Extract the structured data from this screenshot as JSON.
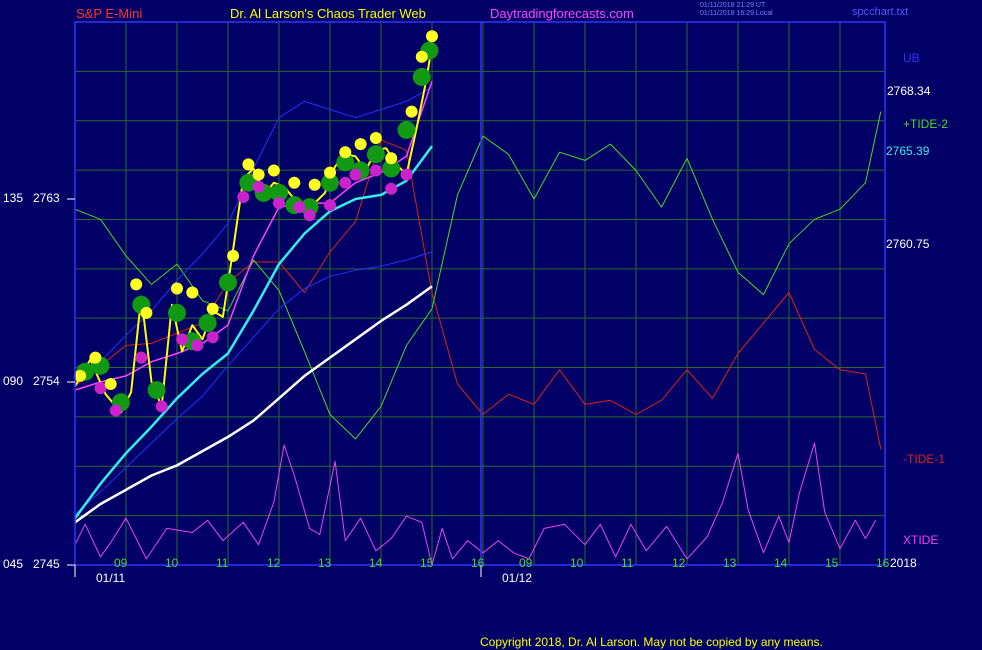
{
  "header": {
    "symbol": "S&P E-Mini",
    "author": "Dr. Al Larson's Chaos Trader Web",
    "site": "Daytradingforecasts.com",
    "timestamp_utc": "01/11/2018 21:29 UT",
    "timestamp_local": "01/11/2018 16:29 Local",
    "file": "spcchart.txt"
  },
  "right_labels": {
    "ub": "UB",
    "ub_price": "2768.34",
    "tide2": "+TIDE-2",
    "tide2_price": "2765.39",
    "mid_price": "2760.75",
    "tide1": "-TIDE-1",
    "xtide": "XTIDE",
    "year": "2018"
  },
  "footer": {
    "copyright": "Copyright 2018, Dr. Al Larson. May not be copied by any means."
  },
  "colors": {
    "background": "#000066",
    "grid": "#2a6a2a",
    "frame": "#3333ff",
    "price": "#ffff00",
    "ma_fast": "#ff44ff",
    "ma_slow": "#33eeee",
    "trend": "#ffffff",
    "band": "#2233ff",
    "tide_green": "#44dd22",
    "tide_red": "#dd2211",
    "xtide": "#ee44ee",
    "bull_marker": "#119911",
    "top_marker": "#ffff22",
    "bottom_marker": "#cc22cc"
  },
  "chart_data": {
    "type": "line",
    "x_ticks": [
      "09",
      "10",
      "11",
      "12",
      "13",
      "14",
      "15",
      "16",
      "09",
      "10",
      "11",
      "12",
      "13",
      "14",
      "15",
      "16"
    ],
    "dates": [
      "01/11",
      "01/12"
    ],
    "y_axis": [
      {
        "code": "135",
        "price": 2763
      },
      {
        "code": "090",
        "price": 2754
      },
      {
        "code": "045",
        "price": 2745
      }
    ],
    "ylim": [
      2745,
      2763
    ],
    "grid": true,
    "series": [
      {
        "name": "S&P E-Mini",
        "x": [
          0,
          0.3,
          0.6,
          0.9,
          1.1,
          1.3,
          1.5,
          1.7,
          1.9,
          2.1,
          2.3,
          2.5,
          2.7,
          2.9,
          3.1,
          3.3,
          3.5,
          3.7,
          3.9,
          4.1,
          4.3,
          4.5,
          4.7,
          4.9,
          5.1,
          5.3,
          5.5,
          5.7,
          5.9,
          6.1,
          6.3,
          6.5,
          6.7,
          6.9,
          7.0
        ],
        "values": [
          2753.8,
          2755.1,
          2753.4,
          2752.5,
          2753.5,
          2758.2,
          2754.0,
          2752.8,
          2757.8,
          2755.5,
          2756.8,
          2756.1,
          2757.5,
          2757.2,
          2760.5,
          2764.0,
          2764.5,
          2763.2,
          2763.8,
          2763.6,
          2763.0,
          2762.4,
          2762.8,
          2763.3,
          2764.6,
          2765.2,
          2765.1,
          2764.4,
          2765.4,
          2765.5,
          2764.7,
          2764.2,
          2766.5,
          2769.0,
          2770.6
        ]
      },
      {
        "name": "Fast MA",
        "x": [
          0,
          0.5,
          1.0,
          1.5,
          2.0,
          2.5,
          3.0,
          3.5,
          4.0,
          4.5,
          5.0,
          5.5,
          6.0,
          6.5,
          7.0
        ],
        "values": [
          2753.6,
          2754.0,
          2754.3,
          2755.0,
          2755.4,
          2755.9,
          2756.8,
          2760.2,
          2762.6,
          2762.8,
          2762.8,
          2763.8,
          2764.3,
          2765.1,
          2768.8
        ]
      },
      {
        "name": "Slow MA",
        "x": [
          0,
          0.5,
          1.0,
          1.5,
          2.0,
          2.5,
          3.0,
          3.5,
          4.0,
          4.5,
          5.0,
          5.5,
          6.0,
          6.5,
          7.0
        ],
        "values": [
          2747.3,
          2749.0,
          2750.5,
          2751.8,
          2753.2,
          2754.4,
          2755.4,
          2757.5,
          2759.8,
          2761.3,
          2762.4,
          2763.0,
          2763.2,
          2763.9,
          2765.6
        ]
      },
      {
        "name": "Trend",
        "x": [
          0,
          0.5,
          1.0,
          1.5,
          2.0,
          2.5,
          3.0,
          3.5,
          4.0,
          4.5,
          5.0,
          5.5,
          6.0,
          6.5,
          7.0
        ],
        "values": [
          2747.1,
          2748.0,
          2748.7,
          2749.4,
          2749.9,
          2750.6,
          2751.3,
          2752.1,
          2753.2,
          2754.3,
          2755.2,
          2756.1,
          2757.0,
          2757.8,
          2758.7
        ]
      },
      {
        "name": "+TIDE-2",
        "x": [
          0,
          0.5,
          1.0,
          1.5,
          2.0,
          2.5,
          3.0,
          3.5,
          4.0,
          4.5,
          5.0,
          5.5,
          6.0,
          6.5,
          7.0,
          7.5,
          8.0,
          8.5,
          9.0,
          9.5,
          10.0,
          10.5,
          11.0,
          11.5,
          12.0,
          12.5,
          13.0,
          13.5,
          14.0,
          14.5,
          15.0,
          15.5,
          15.8
        ],
        "values": [
          2762.5,
          2762.0,
          2760.2,
          2758.8,
          2759.8,
          2758.0,
          2757.5,
          2760.0,
          2758.5,
          2755.5,
          2752.4,
          2751.2,
          2752.8,
          2755.8,
          2757.6,
          2763.2,
          2766.1,
          2765.2,
          2763.0,
          2765.3,
          2764.9,
          2765.7,
          2764.4,
          2762.6,
          2765.0,
          2762.0,
          2759.4,
          2758.3,
          2760.8,
          2762.0,
          2762.5,
          2763.8,
          2767.3
        ]
      },
      {
        "name": "-TIDE-1",
        "x": [
          0,
          0.5,
          1.0,
          1.5,
          2.0,
          2.5,
          3.0,
          3.5,
          4.0,
          4.5,
          5.0,
          5.5,
          6.0,
          6.5,
          7.0,
          7.5,
          8.0,
          8.5,
          9.0,
          9.5,
          10.0,
          10.5,
          11.0,
          11.5,
          12.0,
          12.5,
          13.0,
          13.5,
          14.0,
          14.5,
          15.0,
          15.5,
          15.8
        ],
        "values": [
          2753.8,
          2754.8,
          2755.8,
          2755.9,
          2756.4,
          2756.9,
          2758.9,
          2759.9,
          2759.9,
          2758.4,
          2760.4,
          2761.9,
          2765.9,
          2765.4,
          2758.4,
          2753.9,
          2752.4,
          2753.4,
          2752.9,
          2754.6,
          2752.9,
          2753.1,
          2752.4,
          2753.1,
          2754.6,
          2753.2,
          2755.4,
          2756.9,
          2758.4,
          2755.6,
          2754.6,
          2754.4,
          2750.7
        ]
      },
      {
        "name": "UB",
        "x": [
          0,
          0.5,
          1.0,
          1.5,
          2.0,
          2.5,
          3.0,
          3.5,
          4.0,
          4.5,
          5.0,
          5.5,
          6.0,
          6.5,
          7.0
        ],
        "values": [
          2754.2,
          2755.0,
          2756.3,
          2757.5,
          2759.0,
          2760.3,
          2761.8,
          2764.5,
          2767.0,
          2767.8,
          2767.4,
          2767.0,
          2767.4,
          2767.8,
          2768.5
        ]
      },
      {
        "name": "LB",
        "x": [
          0,
          0.5,
          1.0,
          1.5,
          2.0,
          2.5,
          3.0,
          3.5,
          4.0,
          4.5,
          5.0,
          5.5,
          6.0,
          6.5,
          7.0
        ],
        "values": [
          2747.5,
          2748.6,
          2749.8,
          2751.0,
          2752.2,
          2753.3,
          2754.8,
          2756.2,
          2757.6,
          2758.6,
          2759.2,
          2759.5,
          2759.7,
          2760.0,
          2760.4
        ]
      },
      {
        "name": "XTIDE",
        "x": [
          0,
          0.2,
          0.5,
          0.7,
          1.0,
          1.4,
          1.8,
          2.3,
          2.6,
          2.9,
          3.3,
          3.6,
          3.9,
          4.1,
          4.3,
          4.6,
          4.8,
          5.1,
          5.3,
          5.6,
          5.9,
          6.2,
          6.5,
          6.8,
          7.0,
          7.2,
          7.4,
          7.7,
          8.0,
          8.3,
          8.6,
          8.9,
          9.2,
          9.6,
          10.0,
          10.3,
          10.6,
          10.9,
          11.2,
          11.6,
          12.0,
          12.4,
          12.7,
          13.0,
          13.2,
          13.5,
          13.8,
          14.0,
          14.2,
          14.5,
          14.7,
          15.0,
          15.3,
          15.5,
          15.7
        ],
        "values": [
          2746.0,
          2747.0,
          2745.4,
          2746.1,
          2747.3,
          2745.3,
          2746.8,
          2746.6,
          2747.2,
          2746.2,
          2747.1,
          2746.0,
          2748.1,
          2750.9,
          2749.4,
          2746.8,
          2746.5,
          2750.1,
          2746.2,
          2747.3,
          2745.7,
          2746.3,
          2747.4,
          2747.1,
          2745.0,
          2746.8,
          2745.3,
          2746.2,
          2745.6,
          2746.2,
          2745.6,
          2745.3,
          2746.8,
          2747.0,
          2746.0,
          2747.0,
          2745.4,
          2747.0,
          2745.7,
          2746.9,
          2745.3,
          2746.4,
          2748.1,
          2750.5,
          2747.7,
          2745.6,
          2747.4,
          2746.1,
          2748.5,
          2751.0,
          2747.6,
          2745.8,
          2747.2,
          2746.3,
          2747.2
        ]
      }
    ],
    "markers": [
      {
        "type": "bull",
        "x": [
          0.2,
          0.5,
          0.9,
          1.3,
          1.6,
          2.0,
          2.3,
          2.6,
          3.0,
          3.4,
          3.7,
          4.0,
          4.3,
          4.6,
          5.0,
          5.3,
          5.6,
          5.9,
          6.2,
          6.5,
          6.8,
          6.95
        ],
        "values": [
          2754.5,
          2754.8,
          2753.0,
          2757.8,
          2753.6,
          2757.4,
          2756.0,
          2756.9,
          2758.9,
          2763.8,
          2763.3,
          2763.3,
          2762.7,
          2762.6,
          2763.8,
          2764.8,
          2764.4,
          2765.2,
          2764.5,
          2766.4,
          2769.0,
          2770.3
        ]
      },
      {
        "type": "top",
        "x": [
          0.1,
          0.4,
          0.7,
          1.2,
          1.4,
          2.0,
          2.3,
          2.7,
          3.1,
          3.4,
          3.6,
          3.9,
          4.3,
          4.7,
          5.0,
          5.3,
          5.6,
          5.9,
          6.2,
          6.6,
          6.8,
          7.0
        ],
        "values": [
          2754.3,
          2755.2,
          2753.9,
          2758.8,
          2757.4,
          2758.6,
          2758.4,
          2757.6,
          2760.2,
          2764.7,
          2764.2,
          2764.4,
          2763.8,
          2763.7,
          2764.3,
          2765.3,
          2765.7,
          2766.0,
          2765.0,
          2767.3,
          2770.0,
          2771.0
        ]
      },
      {
        "type": "bottom",
        "x": [
          0.5,
          0.8,
          1.3,
          1.7,
          2.1,
          2.4,
          2.7,
          3.3,
          3.6,
          4.0,
          4.4,
          4.6,
          5.0,
          5.3,
          5.5,
          5.9,
          6.2,
          6.5
        ],
        "values": [
          2753.7,
          2752.6,
          2755.2,
          2752.8,
          2756.1,
          2755.8,
          2756.2,
          2763.1,
          2763.6,
          2762.8,
          2762.6,
          2762.2,
          2762.7,
          2763.8,
          2764.2,
          2764.4,
          2763.5,
          2764.2
        ]
      }
    ]
  }
}
